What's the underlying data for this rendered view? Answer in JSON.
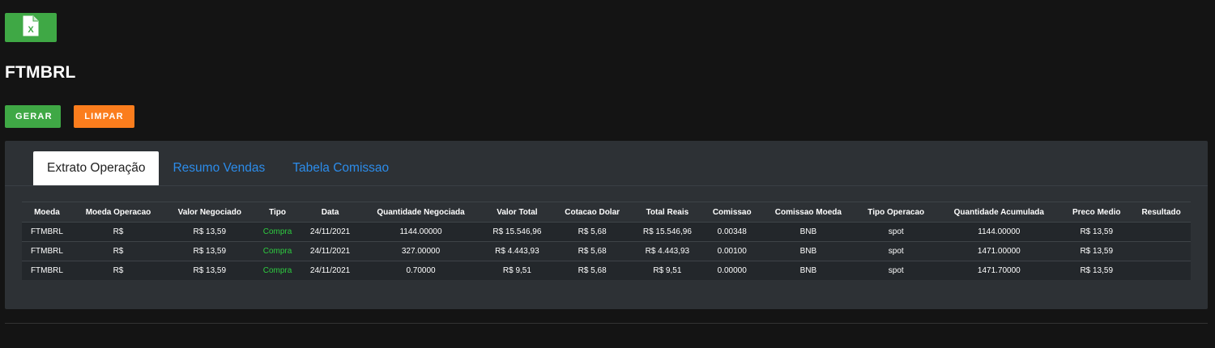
{
  "toolbar": {
    "excel_icon": "excel-file-icon",
    "excel_color": "#3fa845"
  },
  "page": {
    "title": "FTMBRL"
  },
  "actions": {
    "gerar_label": "GERAR",
    "limpar_label": "LIMPAR",
    "gerar_color": "#3fa845",
    "limpar_color": "#fb7d1d"
  },
  "tabs": [
    {
      "label": "Extrato Operação",
      "active": true
    },
    {
      "label": "Resumo Vendas",
      "active": false
    },
    {
      "label": "Tabela Comissao",
      "active": false
    }
  ],
  "table": {
    "headers": [
      "Moeda",
      "Moeda Operacao",
      "Valor Negociado",
      "Tipo",
      "Data",
      "Quantidade Negociada",
      "Valor Total",
      "Cotacao Dolar",
      "Total Reais",
      "Comissao",
      "Comissao Moeda",
      "Tipo Operacao",
      "Quantidade Acumulada",
      "Preco Medio",
      "Resultado"
    ],
    "rows": [
      [
        "FTMBRL",
        "R$",
        "R$ 13,59",
        "Compra",
        "24/11/2021",
        "1144.00000",
        "R$ 15.546,96",
        "R$ 5,68",
        "R$ 15.546,96",
        "0.00348",
        "BNB",
        "spot",
        "1144.00000",
        "R$ 13,59",
        ""
      ],
      [
        "FTMBRL",
        "R$",
        "R$ 13,59",
        "Compra",
        "24/11/2021",
        "327.00000",
        "R$ 4.443,93",
        "R$ 5,68",
        "R$ 4.443,93",
        "0.00100",
        "BNB",
        "spot",
        "1471.00000",
        "R$ 13,59",
        ""
      ],
      [
        "FTMBRL",
        "R$",
        "R$ 13,59",
        "Compra",
        "24/11/2021",
        "0.70000",
        "R$ 9,51",
        "R$ 5,68",
        "R$ 9,51",
        "0.00000",
        "BNB",
        "spot",
        "1471.70000",
        "R$ 13,59",
        ""
      ]
    ]
  }
}
